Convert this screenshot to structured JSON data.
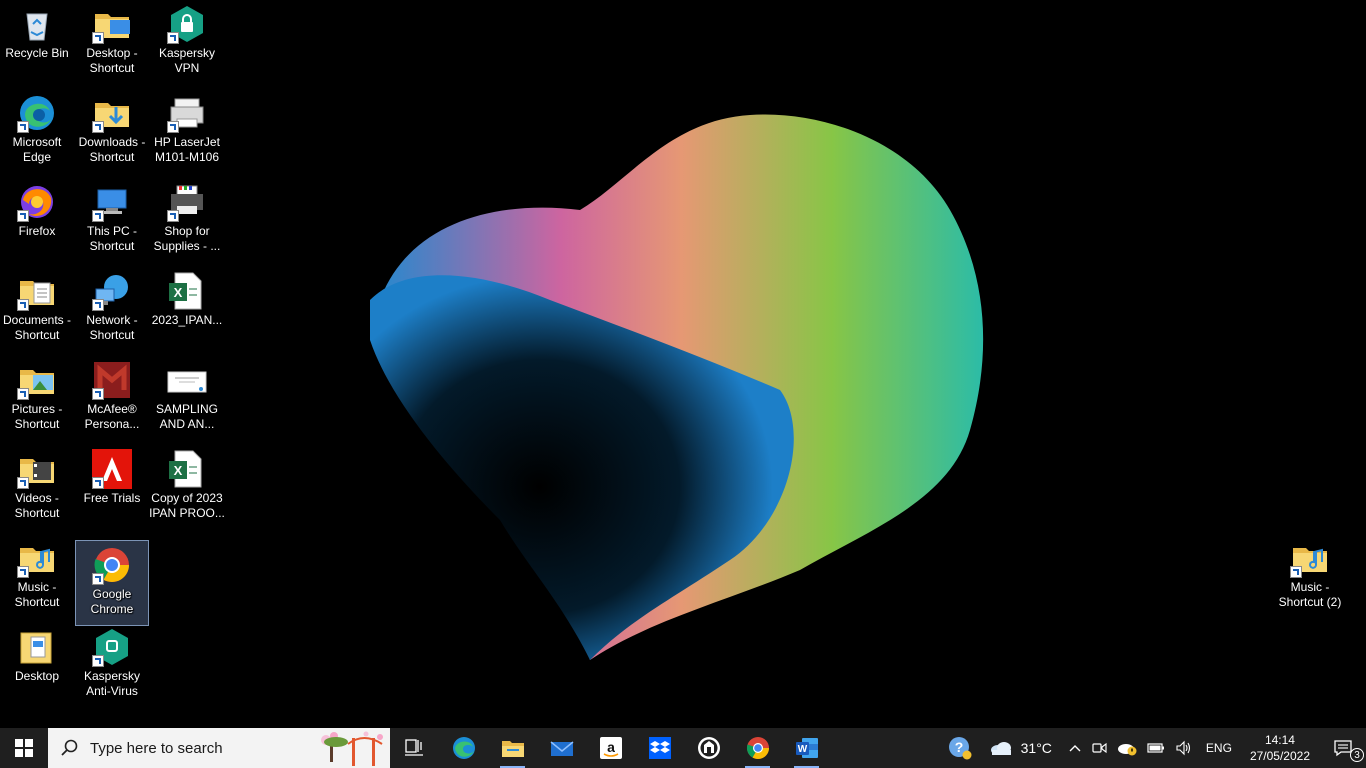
{
  "desktop_icons": [
    {
      "id": "recycle",
      "label": "Recycle Bin",
      "icon": "recycle-bin-icon"
    },
    {
      "id": "desktop-sc",
      "label": "Desktop -\nShortcut",
      "icon": "folder-icon"
    },
    {
      "id": "kvpn",
      "label": "Kaspersky\nVPN",
      "icon": "kaspersky-vpn-icon"
    },
    {
      "id": "edge",
      "label": "Microsoft\nEdge",
      "icon": "edge-icon"
    },
    {
      "id": "downloads",
      "label": "Downloads -\nShortcut",
      "icon": "downloads-folder-icon"
    },
    {
      "id": "hp",
      "label": "HP LaserJet\nM101-M106",
      "icon": "printer-icon"
    },
    {
      "id": "firefox",
      "label": "Firefox",
      "icon": "firefox-icon"
    },
    {
      "id": "thispc",
      "label": "This PC -\nShortcut",
      "icon": "computer-icon"
    },
    {
      "id": "shop",
      "label": "Shop for\nSupplies - ...",
      "icon": "shop-printer-icon"
    },
    {
      "id": "documents",
      "label": "Documents -\nShortcut",
      "icon": "documents-folder-icon"
    },
    {
      "id": "network",
      "label": "Network -\nShortcut",
      "icon": "network-icon"
    },
    {
      "id": "ipan",
      "label": "2023_IPAN...",
      "icon": "excel-icon"
    },
    {
      "id": "pictures",
      "label": "Pictures -\nShortcut",
      "icon": "pictures-folder-icon"
    },
    {
      "id": "mcafee",
      "label": "McAfee®\nPersona...",
      "icon": "mcafee-icon"
    },
    {
      "id": "sampling",
      "label": "SAMPLING\nAND AN...",
      "icon": "document-thumbnail-icon"
    },
    {
      "id": "videos",
      "label": "Videos -\nShortcut",
      "icon": "videos-folder-icon"
    },
    {
      "id": "adobe",
      "label": "Free Trials",
      "icon": "adobe-icon"
    },
    {
      "id": "copyipan",
      "label": "Copy of 2023\nIPAN PROO...",
      "icon": "excel-icon"
    },
    {
      "id": "music",
      "label": "Music -\nShortcut",
      "icon": "music-folder-icon"
    },
    {
      "id": "chrome",
      "label": "Google\nChrome",
      "icon": "chrome-icon"
    },
    {
      "id": "desktop",
      "label": "Desktop",
      "icon": "desktop-folder-icon"
    },
    {
      "id": "kav",
      "label": "Kaspersky\nAnti-Virus",
      "icon": "kaspersky-antivirus-icon"
    },
    {
      "id": "music2",
      "label": "Music -\nShortcut (2)",
      "icon": "music-folder-icon"
    }
  ],
  "taskbar": {
    "search_placeholder": "Type here to search",
    "apps": [
      "task-view-icon",
      "edge-icon",
      "file-explorer-icon",
      "mail-icon",
      "amazon-icon",
      "dropbox-icon",
      "app-icon",
      "chrome-icon",
      "word-icon"
    ],
    "weather": "31°C",
    "language": "ENG",
    "time": "14:14",
    "date": "27/05/2022",
    "notifications": "3"
  },
  "colors": {
    "taskbar": "#1f1f1f",
    "search_bg": "#f3f3f3",
    "selection": "#7896c8"
  }
}
